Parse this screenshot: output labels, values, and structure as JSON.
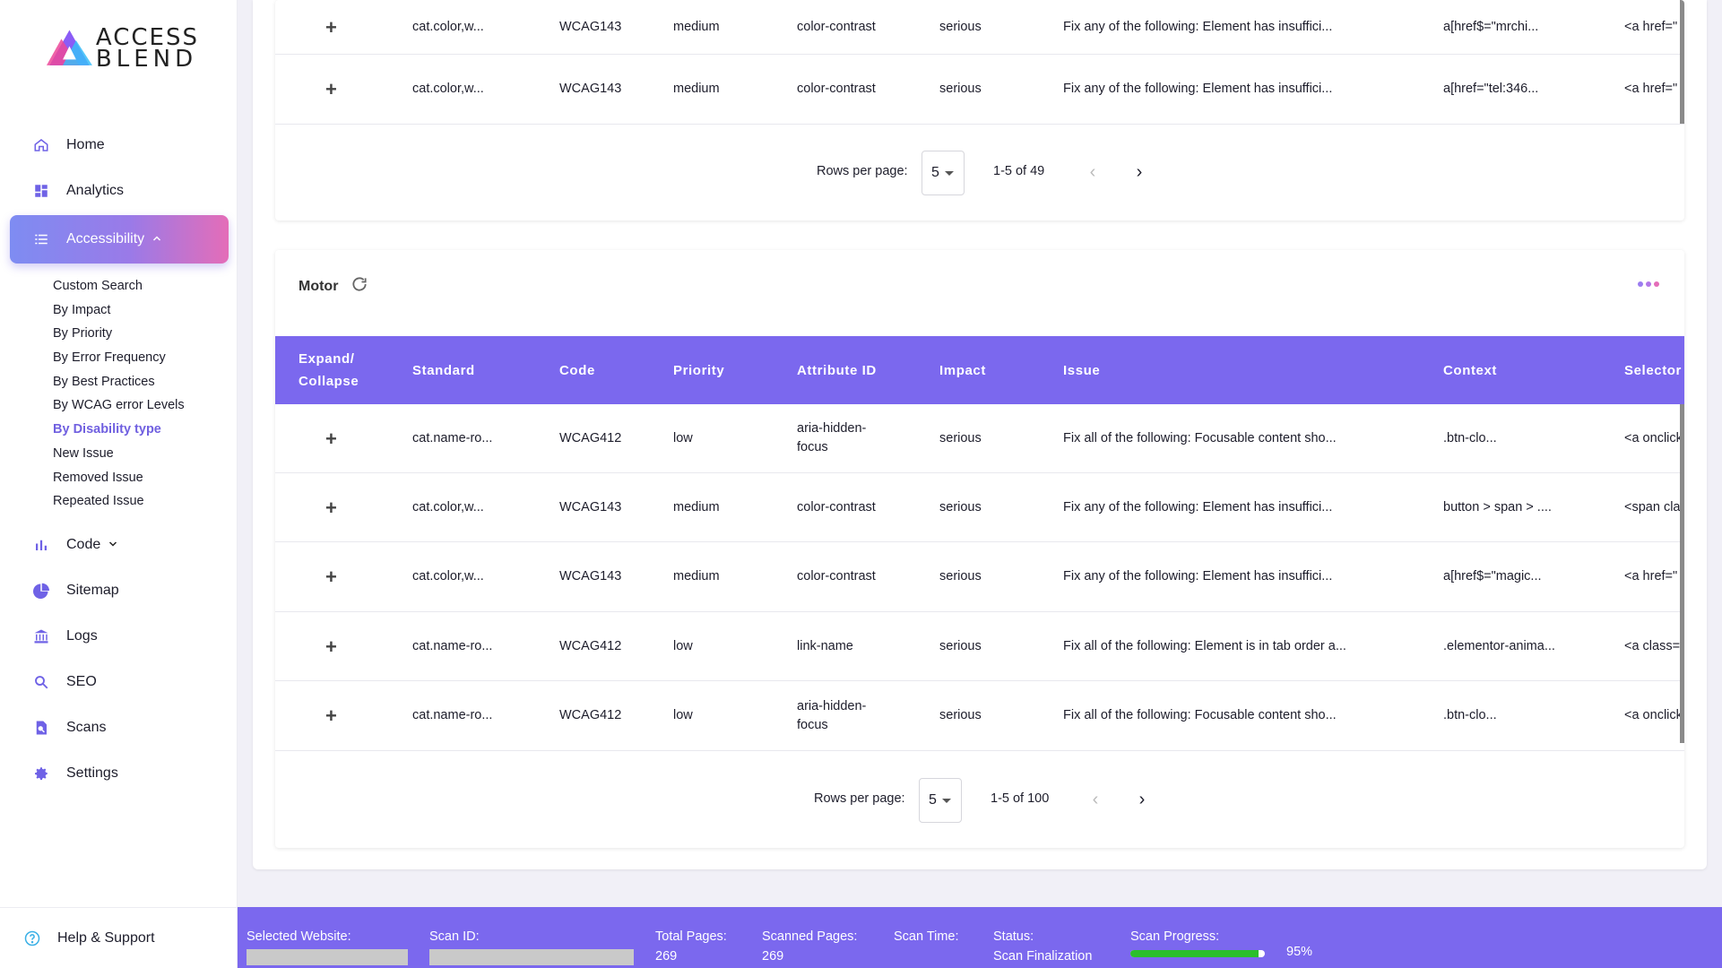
{
  "logo": {
    "line1": "ACCESS",
    "line2": "BLEND"
  },
  "sidebar": {
    "items": [
      {
        "label": "Home",
        "icon": "home-icon"
      },
      {
        "label": "Analytics",
        "icon": "dashboard-icon"
      },
      {
        "label": "Accessibility",
        "icon": "list-icon",
        "active": true
      },
      {
        "label": "Code",
        "icon": "bar-chart-icon"
      },
      {
        "label": "Sitemap",
        "icon": "pie-chart-icon"
      },
      {
        "label": "Logs",
        "icon": "bank-icon"
      },
      {
        "label": "SEO",
        "icon": "search-icon"
      },
      {
        "label": "Scans",
        "icon": "scan-icon"
      },
      {
        "label": "Settings",
        "icon": "gear-icon"
      }
    ],
    "subitems": [
      "Custom Search",
      "By Impact",
      "By Priority",
      "By Error Frequency",
      "By Best Practices",
      "By WCAG error Levels",
      "By Disability type",
      "New Issue",
      "Removed Issue",
      "Repeated Issue"
    ],
    "current_subitem": "By Disability type",
    "help": "Help & Support"
  },
  "top_card": {
    "rows": [
      {
        "standard": "cat.color,w...",
        "code": "WCAG143",
        "priority": "medium",
        "attribute": "color-contrast",
        "impact": "serious",
        "issue": "Fix any of the following: Element has insuffici...",
        "context": "a[href$=\"mrchi...",
        "selector": "<a href=\""
      },
      {
        "standard": "cat.color,w...",
        "code": "WCAG143",
        "priority": "medium",
        "attribute": "color-contrast",
        "impact": "serious",
        "issue": "Fix any of the following: Element has insuffici...",
        "context": "a[href=\"tel:346...",
        "selector": "<a href=\""
      }
    ],
    "pager": {
      "rows_label": "Rows per page:",
      "rows_value": "5",
      "range": "1-5 of 49"
    }
  },
  "motor_card": {
    "title": "Motor",
    "columns": [
      "Expand/ Collapse",
      "Standard",
      "Code",
      "Priority",
      "Attribute ID",
      "Impact",
      "Issue",
      "Context",
      "Selector"
    ],
    "rows": [
      {
        "standard": "cat.name-ro...",
        "code": "WCAG412",
        "priority": "low",
        "attribute": "aria-hidden-focus",
        "impact": "serious",
        "issue": "Fix all of the following: Focusable content sho...",
        "context": ".btn-clo...",
        "selector": "<a onclick"
      },
      {
        "standard": "cat.color,w...",
        "code": "WCAG143",
        "priority": "medium",
        "attribute": "color-contrast",
        "impact": "serious",
        "issue": "Fix any of the following: Element has insuffici...",
        "context": "button > span > ....",
        "selector": "<span cla"
      },
      {
        "standard": "cat.color,w...",
        "code": "WCAG143",
        "priority": "medium",
        "attribute": "color-contrast",
        "impact": "serious",
        "issue": "Fix any of the following: Element has insuffici...",
        "context": "a[href$=\"magic...",
        "selector": "<a href=\""
      },
      {
        "standard": "cat.name-ro...",
        "code": "WCAG412",
        "priority": "low",
        "attribute": "link-name",
        "impact": "serious",
        "issue": "Fix all of the following: Element is in tab order a...",
        "context": ".elementor-anima...",
        "selector": "<a class="
      },
      {
        "standard": "cat.name-ro...",
        "code": "WCAG412",
        "priority": "low",
        "attribute": "aria-hidden-focus",
        "impact": "serious",
        "issue": "Fix all of the following: Focusable content sho...",
        "context": ".btn-clo...",
        "selector": "<a onclick"
      }
    ],
    "pager": {
      "rows_label": "Rows per page:",
      "rows_value": "5",
      "range": "1-5 of 100"
    }
  },
  "status": {
    "website_label": "Selected Website:",
    "scan_id_label": "Scan ID:",
    "total_pages_label": "Total Pages:",
    "total_pages": "269",
    "scanned_pages_label": "Scanned Pages:",
    "scanned_pages": "269",
    "scan_time_label": "Scan Time:",
    "status_label": "Status:",
    "status_value": "Scan Finalization",
    "progress_label": "Scan Progress:",
    "progress_text": "95%",
    "progress_percent": 95
  },
  "colors": {
    "accent": "#7b68ee",
    "brand_pink": "#e46db8",
    "progress": "#2bbf2b"
  }
}
